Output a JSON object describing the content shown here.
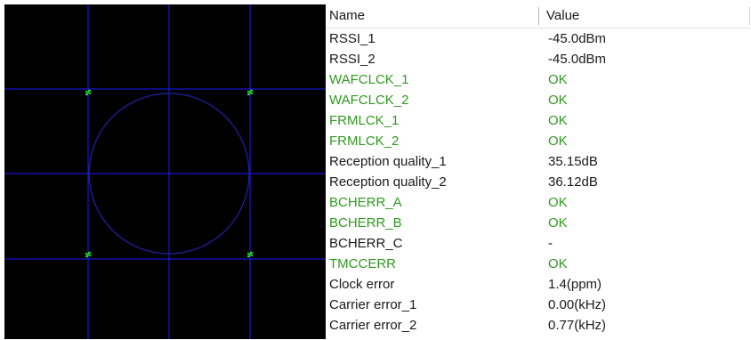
{
  "colors": {
    "ok": "#2f9a1f",
    "normal": "#1a1a1a",
    "grid": "#1a1aff",
    "circle": "#1c1c8c",
    "marker": "#23d42a",
    "background": "#000000"
  },
  "constellation": {
    "icon": "constellation-diagram",
    "points": [
      {
        "i": 1,
        "q": 1
      },
      {
        "i": -1,
        "q": 1
      },
      {
        "i": -1,
        "q": -1
      },
      {
        "i": 1,
        "q": -1
      }
    ]
  },
  "table": {
    "headers": {
      "name": "Name",
      "value": "Value"
    },
    "rows": [
      {
        "name": "RSSI_1",
        "value": "-45.0dBm",
        "status": "normal"
      },
      {
        "name": "RSSI_2",
        "value": "-45.0dBm",
        "status": "normal"
      },
      {
        "name": "WAFCLCK_1",
        "value": "OK",
        "status": "ok"
      },
      {
        "name": "WAFCLCK_2",
        "value": "OK",
        "status": "ok"
      },
      {
        "name": "FRMLCK_1",
        "value": "OK",
        "status": "ok"
      },
      {
        "name": "FRMLCK_2",
        "value": "OK",
        "status": "ok"
      },
      {
        "name": "Reception quality_1",
        "value": "35.15dB",
        "status": "normal"
      },
      {
        "name": "Reception quality_2",
        "value": "36.12dB",
        "status": "normal"
      },
      {
        "name": "BCHERR_A",
        "value": "OK",
        "status": "ok"
      },
      {
        "name": "BCHERR_B",
        "value": "OK",
        "status": "ok"
      },
      {
        "name": "BCHERR_C",
        "value": "-",
        "status": "normal"
      },
      {
        "name": "TMCCERR",
        "value": "OK",
        "status": "ok"
      },
      {
        "name": "Clock error",
        "value": "1.4(ppm)",
        "status": "normal"
      },
      {
        "name": "Carrier error_1",
        "value": "0.00(kHz)",
        "status": "normal"
      },
      {
        "name": "Carrier error_2",
        "value": "0.77(kHz)",
        "status": "normal"
      }
    ]
  }
}
